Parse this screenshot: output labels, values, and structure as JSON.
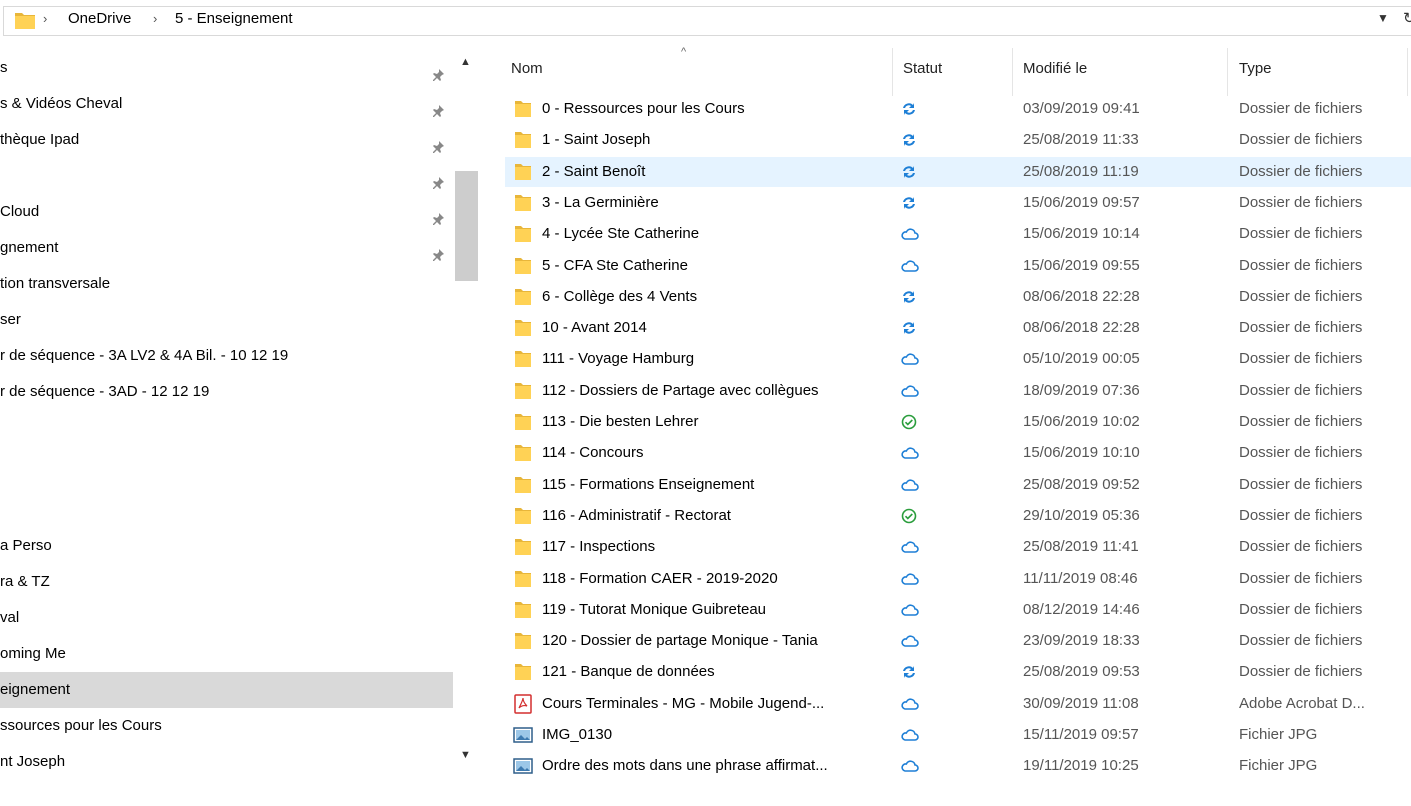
{
  "address": {
    "crumbs": [
      "OneDrive",
      "5 - Enseignement"
    ],
    "separator": "›"
  },
  "nav": {
    "items": [
      {
        "label": "s",
        "pinned": true
      },
      {
        "label": "s & Vidéos Cheval",
        "pinned": true
      },
      {
        "label": "thèque Ipad",
        "pinned": true
      },
      {
        "label": "",
        "pinned": true
      },
      {
        "label": "Cloud",
        "pinned": true
      },
      {
        "label": "gnement",
        "pinned": true
      },
      {
        "label": "tion transversale",
        "pinned": false
      },
      {
        "label": "ser",
        "pinned": false
      },
      {
        "label": "r de séquence  - 3A LV2 & 4A Bil. - 10 12 19",
        "pinned": false
      },
      {
        "label": "r de séquence  - 3AD - 12 12 19",
        "pinned": false
      },
      {
        "label": "",
        "pinned": false
      },
      {
        "label": "",
        "pinned": false
      },
      {
        "label": "",
        "pinned": false
      },
      {
        "label": "",
        "pinned": false
      },
      {
        "label": "a Perso",
        "pinned": false
      },
      {
        "label": "ra & TZ",
        "pinned": false
      },
      {
        "label": "val",
        "pinned": false
      },
      {
        "label": "oming Me",
        "pinned": false
      },
      {
        "label": "eignement",
        "pinned": false,
        "selected": true
      },
      {
        "label": "ssources pour les Cours",
        "pinned": false
      },
      {
        "label": "nt Joseph",
        "pinned": false
      }
    ]
  },
  "columns": {
    "name": "Nom",
    "status": "Statut",
    "modified": "Modifié le",
    "type": "Type"
  },
  "files": [
    {
      "name": "0 - Ressources pour les Cours",
      "status": "sync",
      "date": "03/09/2019 09:41",
      "type": "Dossier de fichiers",
      "icon": "folder"
    },
    {
      "name": "1 - Saint Joseph",
      "status": "sync",
      "date": "25/08/2019 11:33",
      "type": "Dossier de fichiers",
      "icon": "folder"
    },
    {
      "name": "2 - Saint Benoît",
      "status": "sync",
      "date": "25/08/2019 11:19",
      "type": "Dossier de fichiers",
      "icon": "folder",
      "highlight": true
    },
    {
      "name": "3 - La Germinière",
      "status": "sync",
      "date": "15/06/2019 09:57",
      "type": "Dossier de fichiers",
      "icon": "folder"
    },
    {
      "name": "4 - Lycée Ste Catherine",
      "status": "cloud",
      "date": "15/06/2019 10:14",
      "type": "Dossier de fichiers",
      "icon": "folder"
    },
    {
      "name": "5 - CFA Ste Catherine",
      "status": "cloud",
      "date": "15/06/2019 09:55",
      "type": "Dossier de fichiers",
      "icon": "folder"
    },
    {
      "name": "6 - Collège des 4 Vents",
      "status": "sync",
      "date": "08/06/2018 22:28",
      "type": "Dossier de fichiers",
      "icon": "folder"
    },
    {
      "name": "10 - Avant 2014",
      "status": "sync",
      "date": "08/06/2018 22:28",
      "type": "Dossier de fichiers",
      "icon": "folder"
    },
    {
      "name": "111 - Voyage Hamburg",
      "status": "cloud",
      "date": "05/10/2019 00:05",
      "type": "Dossier de fichiers",
      "icon": "folder"
    },
    {
      "name": "112 - Dossiers de Partage avec collègues",
      "status": "cloud",
      "date": "18/09/2019 07:36",
      "type": "Dossier de fichiers",
      "icon": "folder"
    },
    {
      "name": "113 - Die besten Lehrer",
      "status": "ok",
      "date": "15/06/2019 10:02",
      "type": "Dossier de fichiers",
      "icon": "folder"
    },
    {
      "name": "114 - Concours",
      "status": "cloud",
      "date": "15/06/2019 10:10",
      "type": "Dossier de fichiers",
      "icon": "folder"
    },
    {
      "name": "115 - Formations Enseignement",
      "status": "cloud",
      "date": "25/08/2019 09:52",
      "type": "Dossier de fichiers",
      "icon": "folder"
    },
    {
      "name": "116 - Administratif - Rectorat",
      "status": "ok",
      "date": "29/10/2019 05:36",
      "type": "Dossier de fichiers",
      "icon": "folder"
    },
    {
      "name": "117 - Inspections",
      "status": "cloud",
      "date": "25/08/2019 11:41",
      "type": "Dossier de fichiers",
      "icon": "folder"
    },
    {
      "name": "118 - Formation CAER - 2019-2020",
      "status": "cloud",
      "date": "11/11/2019 08:46",
      "type": "Dossier de fichiers",
      "icon": "folder"
    },
    {
      "name": "119 - Tutorat Monique Guibreteau",
      "status": "cloud",
      "date": "08/12/2019 14:46",
      "type": "Dossier de fichiers",
      "icon": "folder"
    },
    {
      "name": "120 - Dossier de partage Monique - Tania",
      "status": "cloud",
      "date": "23/09/2019 18:33",
      "type": "Dossier de fichiers",
      "icon": "folder"
    },
    {
      "name": "121 - Banque de données",
      "status": "sync",
      "date": "25/08/2019 09:53",
      "type": "Dossier de fichiers",
      "icon": "folder"
    },
    {
      "name": "Cours Terminales  - MG - Mobile Jugend-...",
      "status": "cloud",
      "date": "30/09/2019 11:08",
      "type": "Adobe Acrobat D...",
      "icon": "pdf"
    },
    {
      "name": "IMG_0130",
      "status": "cloud",
      "date": "15/11/2019 09:57",
      "type": "Fichier JPG",
      "icon": "image"
    },
    {
      "name": "Ordre des mots dans une phrase affirmat...",
      "status": "cloud",
      "date": "19/11/2019 10:25",
      "type": "Fichier JPG",
      "icon": "image"
    }
  ],
  "colors": {
    "folder": "#ffd255",
    "folderDark": "#e8b63a",
    "sync": "#1e7fd6",
    "cloud": "#1e7fd6",
    "ok": "#2a9d3c",
    "pdf": "#d32f2f",
    "highlight": "#e5f3ff",
    "selected": "#d9d9d9"
  }
}
